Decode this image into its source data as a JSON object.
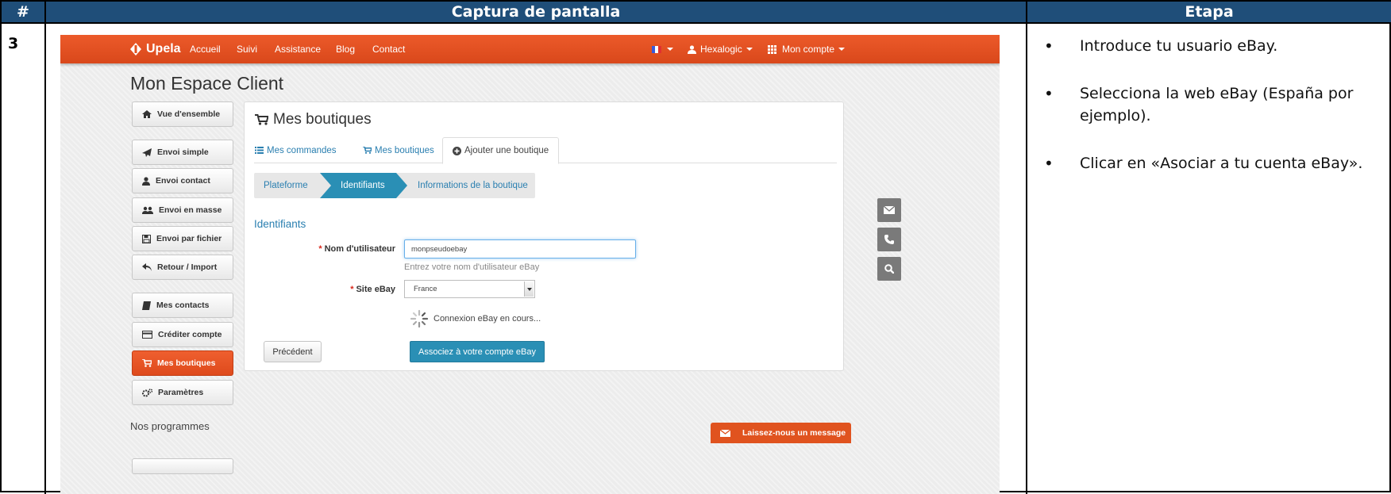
{
  "doc": {
    "headers": {
      "number": "#",
      "capture": "Captura de pantalla",
      "step": "Etapa"
    },
    "row_number": "3",
    "steps": [
      "Introduce tu usuario eBay.",
      "Selecciona la web eBay (España por ejemplo).",
      "Clicar en «Asociar a tu cuenta eBay»."
    ]
  },
  "topnav": {
    "brand": "Upela",
    "links": [
      "Accueil",
      "Suivi",
      "Assistance",
      "Blog",
      "Contact"
    ],
    "user": "Hexalogic",
    "account": "Mon compte",
    "accent_color": "#e4511f"
  },
  "page_title": "Mon Espace Client",
  "sidebar": {
    "items": [
      {
        "label": "Vue d'ensemble",
        "icon": "home-icon"
      },
      {
        "label": "Envoi simple",
        "icon": "send-icon"
      },
      {
        "label": "Envoi contact",
        "icon": "user-icon"
      },
      {
        "label": "Envoi en masse",
        "icon": "users-icon"
      },
      {
        "label": "Envoi par fichier",
        "icon": "file-icon"
      },
      {
        "label": "Retour / Import",
        "icon": "reply-icon"
      },
      {
        "label": "Mes contacts",
        "icon": "book-icon"
      },
      {
        "label": "Créditer compte",
        "icon": "credit-card-icon"
      },
      {
        "label": "Mes boutiques",
        "icon": "cart-icon",
        "active": true
      },
      {
        "label": "Paramètres",
        "icon": "gears-icon"
      }
    ],
    "section_label": "Nos programmes"
  },
  "panel": {
    "title": "Mes boutiques",
    "tabs": [
      {
        "label": "Mes commandes",
        "icon": "list-icon"
      },
      {
        "label": "Mes boutiques",
        "icon": "cart-icon"
      },
      {
        "label": "Ajouter une boutique",
        "icon": "plus-circle-icon",
        "active": true
      }
    ],
    "wizard": [
      "Plateforme",
      "Identifiants",
      "Informations de la boutique"
    ],
    "wizard_active": "Identifiants",
    "form_heading": "Identifiants",
    "username_label": "Nom d'utilisateur",
    "username_value": "monpseudoebay",
    "username_help": "Entrez votre nom d'utilisateur eBay",
    "site_label": "Site eBay",
    "site_value": "France",
    "required_mark": "*",
    "loading_text": "Connexion eBay en cours...",
    "prev_button": "Précédent",
    "associate_button": "Associez à votre compte eBay"
  },
  "message_bar": "Laissez-nous un message"
}
